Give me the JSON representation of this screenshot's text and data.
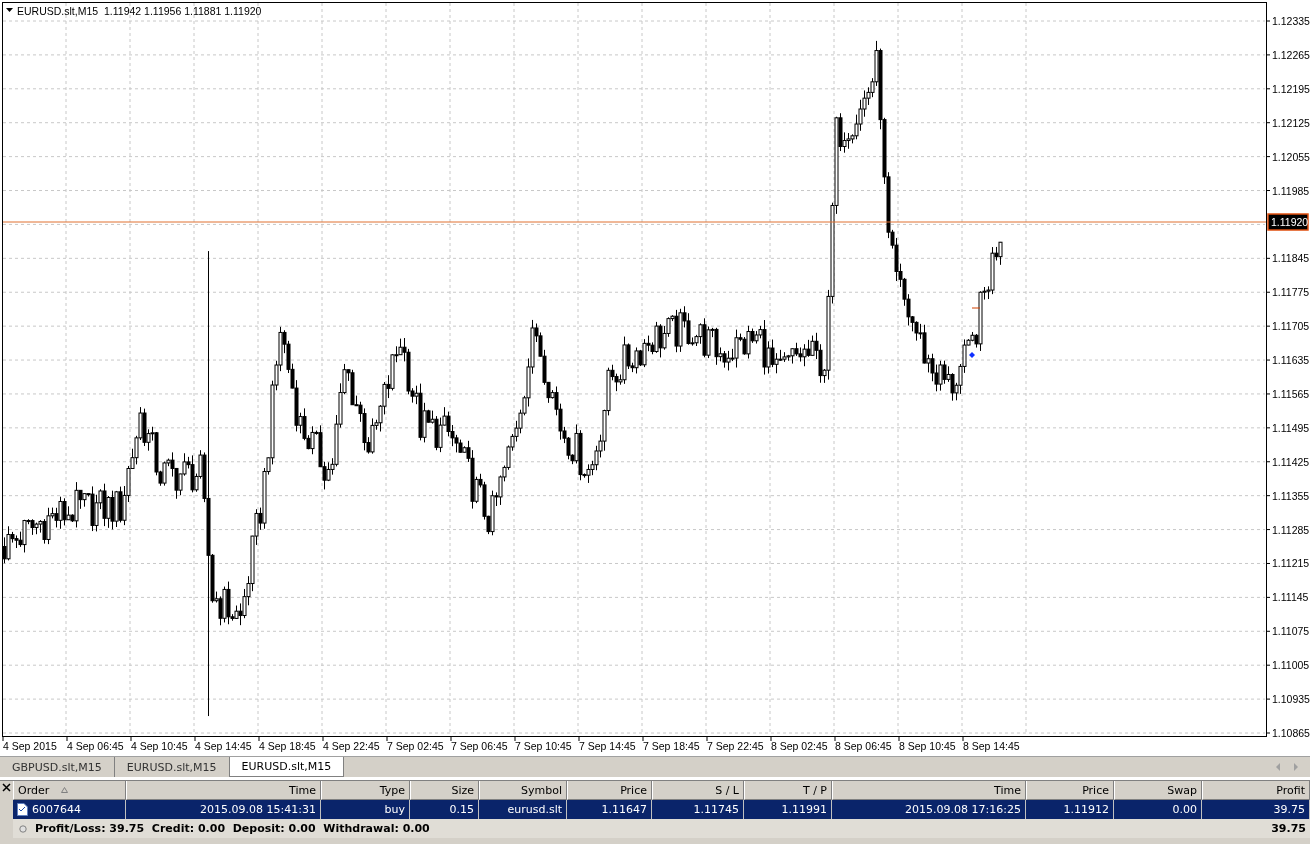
{
  "chart": {
    "symbol": "EURUSD.slt,M15",
    "ohlc": [
      "1.11942",
      "1.11956",
      "1.11881",
      "1.11920"
    ],
    "price_axis": [
      "1.12335",
      "1.12265",
      "1.12195",
      "1.12125",
      "1.12055",
      "1.11985",
      "1.11845",
      "1.11775",
      "1.11705",
      "1.11635",
      "1.11565",
      "1.11495",
      "1.11425",
      "1.11355",
      "1.11285",
      "1.11215",
      "1.11145",
      "1.11075",
      "1.11005",
      "1.10935",
      "1.10865"
    ],
    "time_axis": [
      "4 Sep 2015",
      "4 Sep 06:45",
      "4 Sep 10:45",
      "4 Sep 14:45",
      "4 Sep 18:45",
      "4 Sep 22:45",
      "7 Sep 02:45",
      "7 Sep 06:45",
      "7 Sep 10:45",
      "7 Sep 14:45",
      "7 Sep 18:45",
      "7 Sep 22:45",
      "8 Sep 02:45",
      "8 Sep 06:45",
      "8 Sep 10:45",
      "8 Sep 14:45"
    ],
    "current_price": "1.11920"
  },
  "tabs": [
    {
      "label": "GBPUSD.slt,M15",
      "selected": false
    },
    {
      "label": "EURUSD.slt,M15",
      "selected": false
    },
    {
      "label": "EURUSD.slt,M15",
      "selected": true
    }
  ],
  "orders": {
    "columns": [
      "Order",
      "Time",
      "Type",
      "Size",
      "Symbol",
      "Price",
      "S / L",
      "T / P",
      "Time",
      "Price",
      "Swap",
      "Profit"
    ],
    "rows": [
      {
        "selected": true,
        "cells": [
          "6007644",
          "2015.09.08 15:41:31",
          "buy",
          "0.15",
          "eurusd.slt",
          "1.11647",
          "1.11745",
          "1.11991",
          "2015.09.08 17:16:25",
          "1.11912",
          "0.00",
          "39.75"
        ]
      }
    ],
    "summary": {
      "text": "Profit/Loss: 39.75  Credit: 0.00  Deposit: 0.00  Withdrawal: 0.00",
      "total": "39.75"
    }
  }
}
